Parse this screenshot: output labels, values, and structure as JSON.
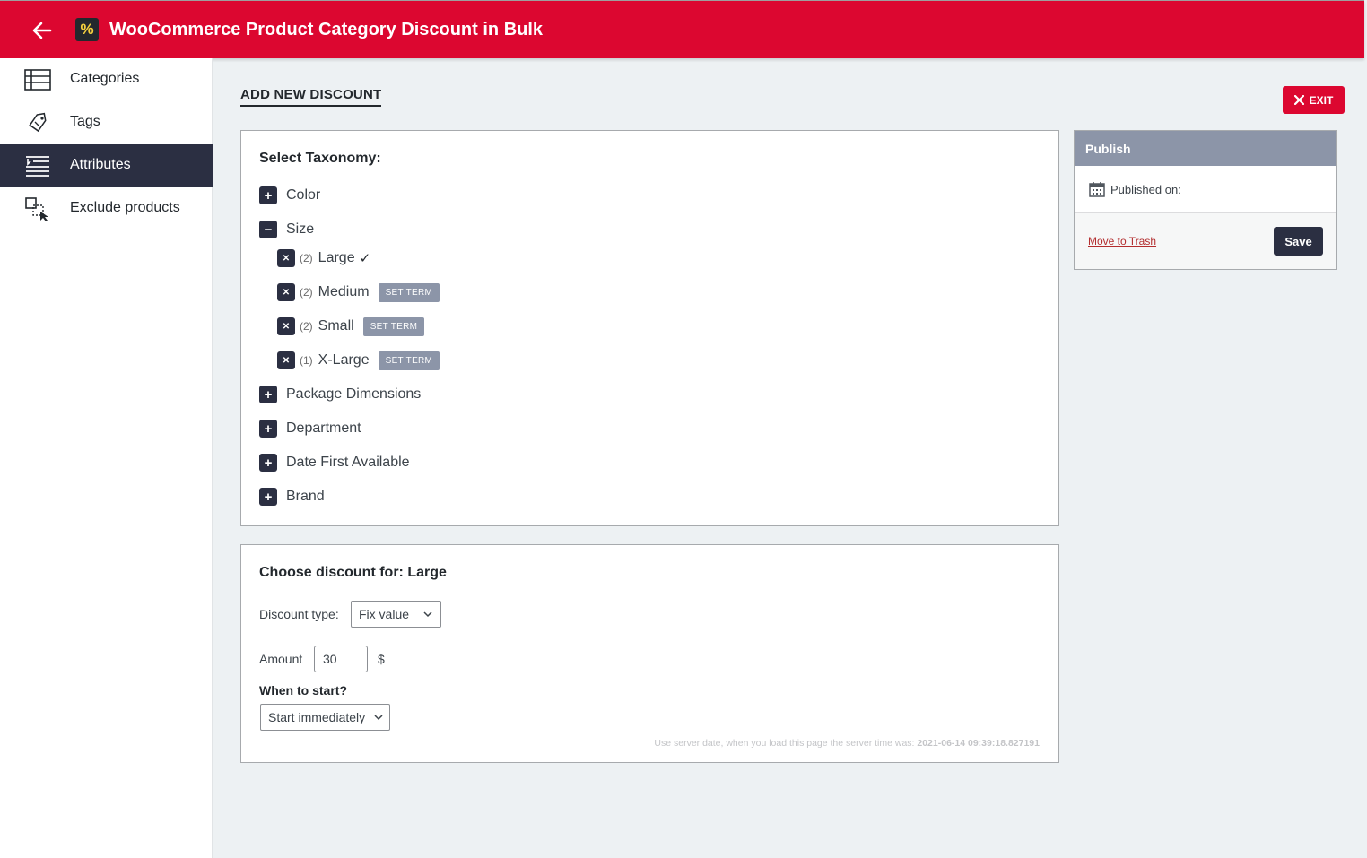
{
  "header": {
    "title": "WooCommerce Product Category Discount in Bulk",
    "logo_glyph": "%",
    "accent_color": "#dc0730",
    "back_icon": "arrow-left-icon"
  },
  "sidebar": {
    "items": [
      {
        "label": "Categories",
        "icon": "list-icon"
      },
      {
        "label": "Tags",
        "icon": "tag-icon"
      },
      {
        "label": "Attributes",
        "icon": "attributes-icon",
        "active": true
      },
      {
        "label": "Exclude products",
        "icon": "exclude-icon"
      }
    ]
  },
  "main": {
    "heading": "ADD NEW DISCOUNT",
    "exit_label": "EXIT"
  },
  "taxonomy": {
    "title": "Select Taxonomy:",
    "groups": [
      {
        "label": "Color",
        "expanded": false
      },
      {
        "label": "Size",
        "expanded": true
      },
      {
        "label": "Package Dimensions",
        "expanded": false
      },
      {
        "label": "Department",
        "expanded": false
      },
      {
        "label": "Date First Available",
        "expanded": false
      },
      {
        "label": "Brand",
        "expanded": false
      }
    ],
    "size_terms": [
      {
        "count": "(2)",
        "name": "Large",
        "selected": true,
        "mark": "✓"
      },
      {
        "count": "(2)",
        "name": "Medium",
        "action": "SET TERM"
      },
      {
        "count": "(2)",
        "name": "Small",
        "action": "SET TERM"
      },
      {
        "count": "(1)",
        "name": "X-Large",
        "action": "SET TERM"
      }
    ]
  },
  "discount": {
    "title": "Choose discount for: Large",
    "type_label": "Discount type:",
    "type_value": "Fix value",
    "amount_label": "Amount",
    "amount_value": "30",
    "currency": "$",
    "start_label": "When to start?",
    "start_value": "Start immediately",
    "server_note": "Use server date, when you load this page the server time was: ",
    "server_time": "2021-06-14 09:39:18.827191"
  },
  "publish": {
    "title": "Publish",
    "published_on": "Published on:",
    "trash_label": "Move to Trash",
    "save_label": "Save"
  }
}
